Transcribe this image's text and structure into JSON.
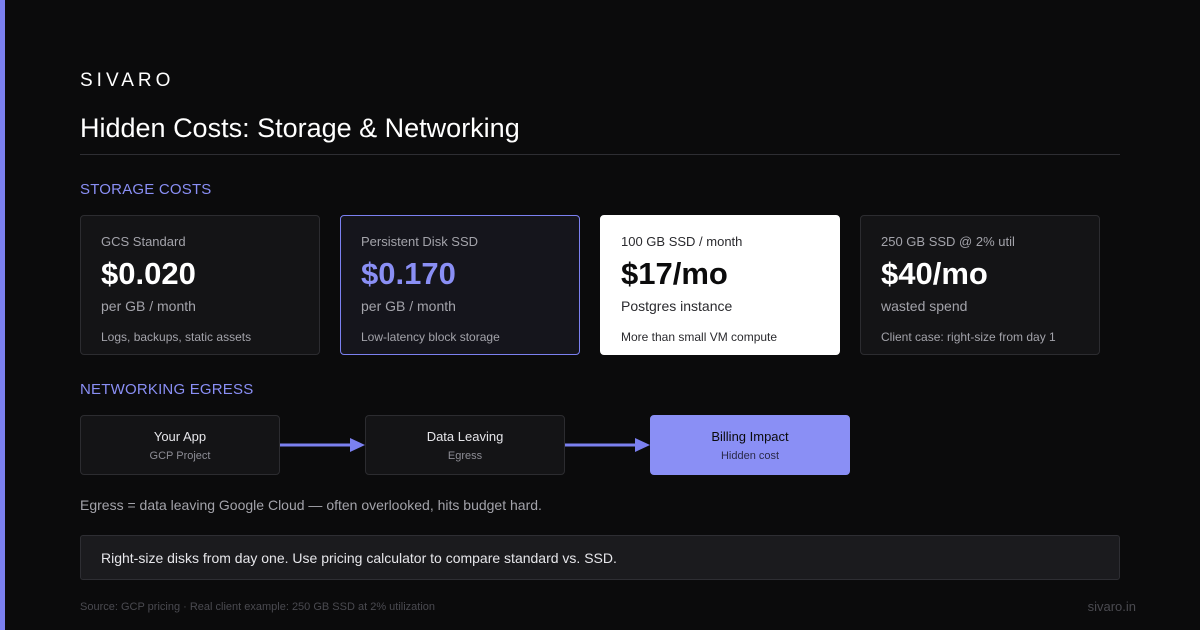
{
  "brand": "SIVARO",
  "title": "Hidden Costs: Storage & Networking",
  "colors": {
    "accent": "#7b80f0",
    "accent_fill": "#8a8ff5",
    "background": "#0b0b0c",
    "card_bg": "#141416"
  },
  "storage": {
    "label": "STORAGE COSTS",
    "cards": [
      {
        "label": "GCS Standard",
        "value": "$0.020",
        "unit": "per GB / month",
        "note": "Logs, backups, static assets"
      },
      {
        "label": "Persistent Disk SSD",
        "value": "$0.170",
        "unit": "per GB / month",
        "note": "Low-latency block storage"
      },
      {
        "label": "100 GB SSD / month",
        "value": "$17/mo",
        "unit": "Postgres instance",
        "note": "More than small VM compute"
      },
      {
        "label": "250 GB SSD @ 2% util",
        "value": "$40/mo",
        "unit": "wasted spend",
        "note": "Client case: right-size from day 1"
      }
    ]
  },
  "egress": {
    "label": "NETWORKING EGRESS",
    "steps": [
      {
        "title": "Your App",
        "sub": "GCP Project"
      },
      {
        "title": "Data Leaving",
        "sub": "Egress"
      },
      {
        "title": "Billing Impact",
        "sub": "Hidden cost"
      }
    ],
    "note": "Egress = data leaving Google Cloud — often overlooked, hits budget hard."
  },
  "callout": "Right-size disks from day one. Use pricing calculator to compare standard vs. SSD.",
  "footer": {
    "source": "Source: GCP pricing · Real client example: 250 GB SSD at 2% utilization",
    "site": "sivaro.in"
  }
}
